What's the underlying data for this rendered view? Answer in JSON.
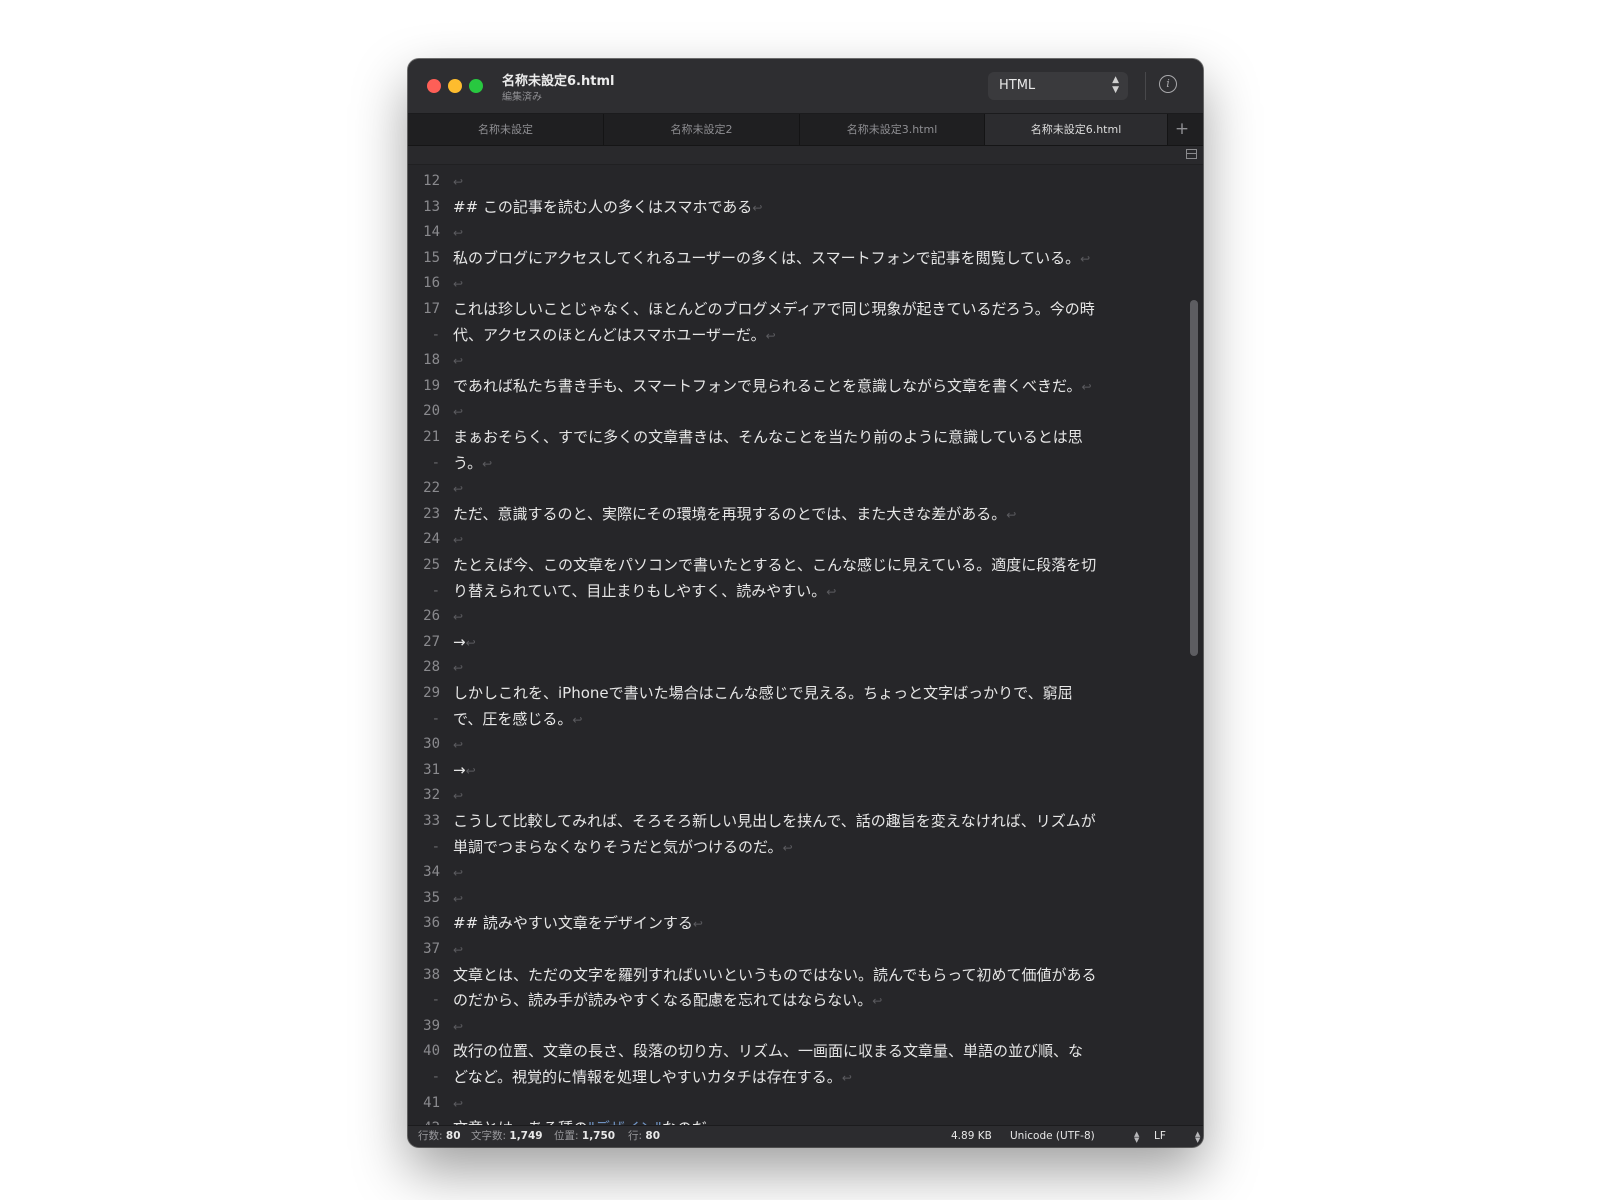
{
  "window": {
    "title": "名称未設定6.html",
    "subtitle": "編集済み",
    "syntax": "HTML"
  },
  "tabs": [
    {
      "label": "名称未設定"
    },
    {
      "label": "名称未設定2"
    },
    {
      "label": "名称未設定3.html"
    },
    {
      "label": "名称未設定6.html",
      "active": true
    }
  ],
  "editor": {
    "lines": [
      {
        "num": "12",
        "text": ""
      },
      {
        "num": "13",
        "text": "## この記事を読む人の多くはスマホである"
      },
      {
        "num": "14",
        "text": ""
      },
      {
        "num": "15",
        "text": "私のブログにアクセスしてくれるユーザーの多くは、スマートフォンで記事を閲覧している。"
      },
      {
        "num": "16",
        "text": ""
      },
      {
        "num": "17",
        "text": "これは珍しいことじゃなく、ほとんどのブログメディアで同じ現象が起きているだろう。今の時",
        "wrap": true
      },
      {
        "num": "-",
        "text": "代、アクセスのほとんどはスマホユーザーだ。"
      },
      {
        "num": "18",
        "text": ""
      },
      {
        "num": "19",
        "text": "であれば私たち書き手も、スマートフォンで見られることを意識しながら文章を書くべきだ。"
      },
      {
        "num": "20",
        "text": ""
      },
      {
        "num": "21",
        "text": "まぁおそらく、すでに多くの文章書きは、そんなことを当たり前のように意識しているとは思",
        "wrap": true
      },
      {
        "num": "-",
        "text": "う。"
      },
      {
        "num": "22",
        "text": ""
      },
      {
        "num": "23",
        "text": "ただ、意識するのと、実際にその環境を再現するのとでは、また大きな差がある。"
      },
      {
        "num": "24",
        "text": ""
      },
      {
        "num": "25",
        "text": "たとえば今、この文章をパソコンで書いたとすると、こんな感じに見えている。適度に段落を切",
        "wrap": true
      },
      {
        "num": "-",
        "text": "り替えられていて、目止まりもしやすく、読みやすい。"
      },
      {
        "num": "26",
        "text": ""
      },
      {
        "num": "27",
        "text": "→",
        "tab": true
      },
      {
        "num": "28",
        "text": ""
      },
      {
        "num": "29",
        "text": "しかしこれを、iPhoneで書いた場合はこんな感じで見える。ちょっと文字ばっかりで、窮屈",
        "wrap": true
      },
      {
        "num": "-",
        "text": "で、圧を感じる。"
      },
      {
        "num": "30",
        "text": ""
      },
      {
        "num": "31",
        "text": "→",
        "tab": true
      },
      {
        "num": "32",
        "text": ""
      },
      {
        "num": "33",
        "text": "こうして比較してみれば、そろそろ新しい見出しを挟んで、話の趣旨を変えなければ、リズムが",
        "wrap": true
      },
      {
        "num": "-",
        "text": "単調でつまらなくなりそうだと気がつけるのだ。"
      },
      {
        "num": "34",
        "text": ""
      },
      {
        "num": "35",
        "text": ""
      },
      {
        "num": "36",
        "text": "## 読みやすい文章をデザインする"
      },
      {
        "num": "37",
        "text": ""
      },
      {
        "num": "38",
        "text": "文章とは、ただの文字を羅列すればいいというものではない。読んでもらって初めて価値がある",
        "wrap": true
      },
      {
        "num": "-",
        "text": "のだから、読み手が読みやすくなる配慮を忘れてはならない。"
      },
      {
        "num": "39",
        "text": ""
      },
      {
        "num": "40",
        "text": "改行の位置、文章の長さ、段落の切り方、リズム、一画面に収まる文章量、単語の並び順、な",
        "wrap": true
      },
      {
        "num": "-",
        "text": "どなど。視覚的に情報を処理しやすいカタチは存在する。"
      },
      {
        "num": "41",
        "text": ""
      },
      {
        "num": "42",
        "text": "文章とは、ある種の",
        "link": "\"デザイン\"",
        "after": "なのだ。"
      }
    ],
    "newline_glyph": "↩"
  },
  "status": {
    "lines_label": "行数:",
    "lines_value": "80",
    "chars_label": "文字数:",
    "chars_value": "1,749",
    "position_label": "位置:",
    "position_value": "1,750",
    "row_label": "行:",
    "row_value": "80",
    "file_size": "4.89 KB",
    "encoding": "Unicode (UTF-8)",
    "line_ending": "LF"
  }
}
